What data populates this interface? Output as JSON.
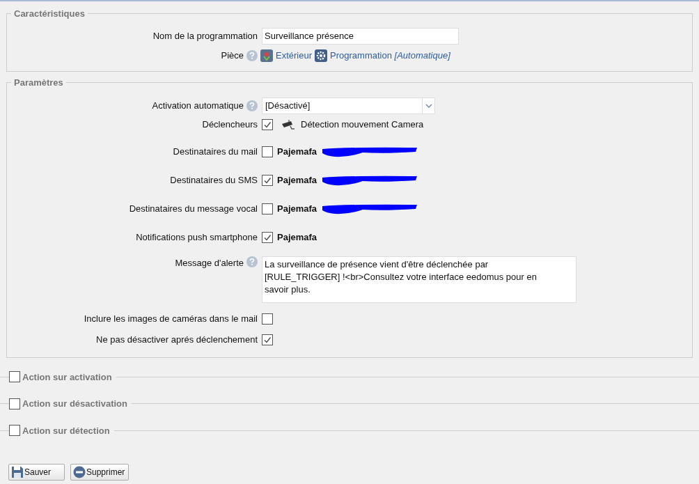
{
  "characteristics": {
    "legend": "Caractéristiques",
    "name_label": "Nom de la programmation",
    "name_value": "Surveillance présence",
    "room_label": "Pièce",
    "room_help": true,
    "room": "Extérieur",
    "program": "Programmation",
    "program_mode": "[Automatique]"
  },
  "parameters": {
    "legend": "Paramètres",
    "rows": [
      {
        "kind": "select",
        "label": "Activation automatique",
        "help": true,
        "value": "[Désactivé]"
      },
      {
        "kind": "trigger",
        "label": "Déclencheurs",
        "checked": true,
        "text": "Détection mouvement Camera"
      },
      {
        "kind": "recipient",
        "label": "Destinataires du mail",
        "checked": false,
        "name": "Pajemafa",
        "redacted": true
      },
      {
        "kind": "recipient",
        "label": "Destinataires du SMS",
        "checked": true,
        "name": "Pajemafa",
        "redacted": true
      },
      {
        "kind": "recipient",
        "label": "Destinataires du message vocal",
        "checked": false,
        "name": "Pajemafa",
        "redacted": true
      },
      {
        "kind": "recipient",
        "label": "Notifications push smartphone",
        "checked": true,
        "name": "Pajemafa",
        "redacted": false
      },
      {
        "kind": "textarea",
        "label": "Message d'alerte",
        "help": true,
        "value": "La surveillance de présence vient d'être déclenchée par [RULE_TRIGGER] !<br>Consultez votre interface eedomus pour en savoir plus."
      },
      {
        "kind": "checkbox",
        "label": "Inclure les images de caméras dans le mail",
        "checked": false
      },
      {
        "kind": "checkbox",
        "label": "Ne pas désactiver aprés déclenchement",
        "checked": true
      }
    ]
  },
  "sections": [
    {
      "label": "Action sur activation",
      "checked": false
    },
    {
      "label": "Action sur désactivation",
      "checked": false
    },
    {
      "label": "Action sur détection",
      "checked": false
    }
  ],
  "buttons": [
    {
      "kind": "save",
      "label": "Sauver"
    },
    {
      "kind": "delete",
      "label": "Supprimer"
    }
  ]
}
